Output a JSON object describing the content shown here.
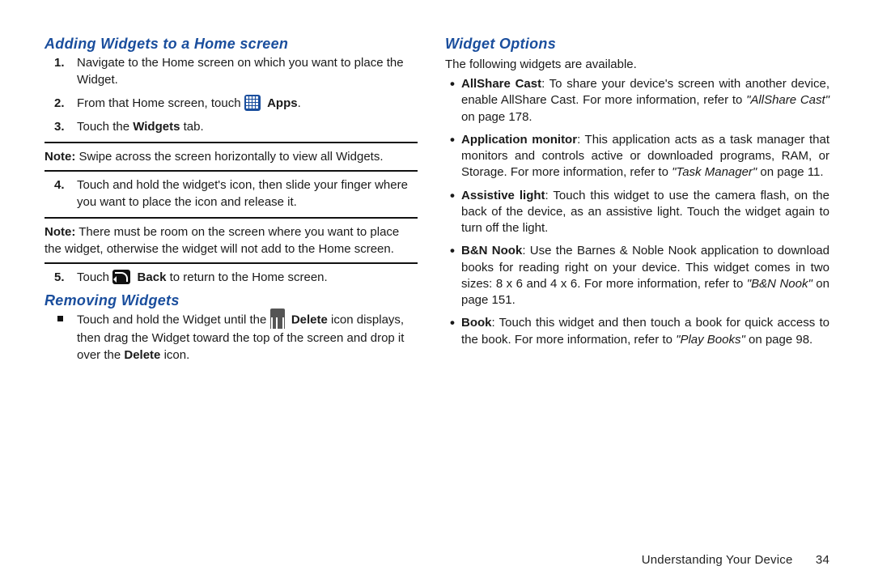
{
  "left": {
    "heading_add": "Adding Widgets to a Home screen",
    "step1": "Navigate to the Home screen on which you want to place the Widget.",
    "step2_pre": "From that Home screen, touch ",
    "step2_apps": "Apps",
    "step2_post": ".",
    "step3_pre": "Touch the ",
    "step3_bold": "Widgets",
    "step3_post": " tab.",
    "note1_label": "Note:",
    "note1_text": " Swipe across the screen horizontally to view all Widgets.",
    "step4": "Touch and hold the widget's icon, then slide your finger where you want to place the icon and release it.",
    "note2_label": "Note:",
    "note2_text": " There must be room on the screen where you want to place the widget, otherwise the widget will not add to the Home screen.",
    "step5_pre": "Touch ",
    "step5_back": "Back",
    "step5_post": " to return to the Home screen.",
    "heading_remove": "Removing Widgets",
    "remove_pre": "Touch and hold the Widget until the ",
    "remove_delete1": "Delete",
    "remove_mid": " icon displays, then drag the Widget toward the top of the screen and drop it over the ",
    "remove_delete2": "Delete",
    "remove_post": " icon."
  },
  "right": {
    "heading_options": "Widget Options",
    "intro": "The following widgets are available.",
    "items": [
      {
        "name": "AllShare Cast",
        "text": ": To share your device's screen with another device, enable AllShare Cast. For more information, refer to ",
        "ref": "\"AllShare Cast\"",
        "ref_post": " on page 178."
      },
      {
        "name": "Application monitor",
        "text": ": This application acts as a task manager that monitors and controls active or downloaded programs, RAM, or Storage. For more information, refer to ",
        "ref": "\"Task Manager\"",
        "ref_post": " on page 11."
      },
      {
        "name": "Assistive light",
        "text": ": Touch this widget to use the camera flash, on the back of the device, as an assistive light. Touch the widget again to turn off the light.",
        "ref": "",
        "ref_post": ""
      },
      {
        "name": "B&N Nook",
        "text": ": Use the Barnes & Noble Nook application to download books for reading right on your device. This widget comes in two sizes: 8 x 6 and 4 x 6. For more information, refer to ",
        "ref": "\"B&N Nook\"",
        "ref_post": " on page 151."
      },
      {
        "name": "Book",
        "text": ": Touch this widget and then touch a book for quick access to the book. For more information, refer to ",
        "ref": "\"Play Books\"",
        "ref_post": " on page 98."
      }
    ]
  },
  "footer": {
    "chapter": "Understanding Your Device",
    "page": "34"
  }
}
